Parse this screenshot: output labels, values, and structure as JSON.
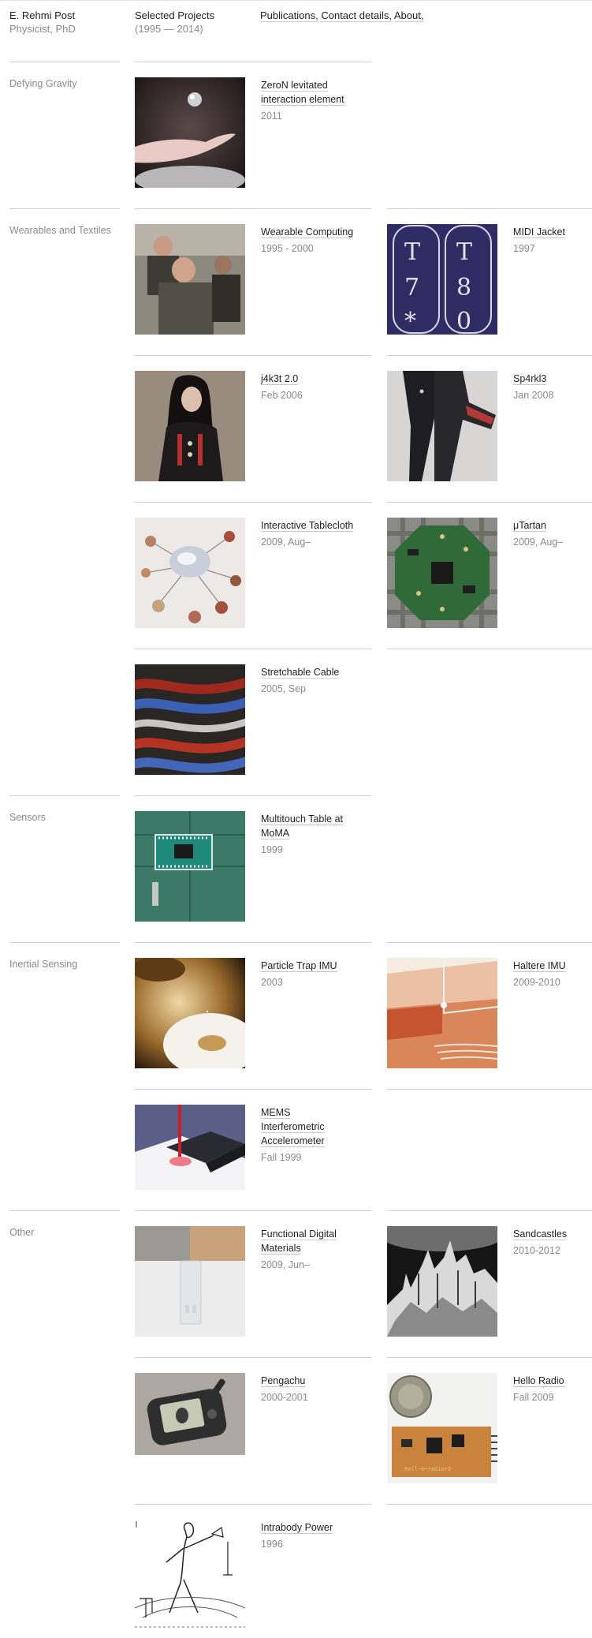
{
  "header": {
    "name": "E. Rehmi Post",
    "subtitle": "Physicist, PhD",
    "section_title": "Selected Projects",
    "section_years": "(1995 — 2014)",
    "nav": [
      "Publications,",
      "Contact details,",
      "About,"
    ]
  },
  "categories": [
    "Defying Gravity",
    "Wearables and Textiles",
    "Sensors",
    "Inertial Sensing",
    "Other"
  ],
  "projects": [
    {
      "title": "ZeroN levitated interaction element",
      "year": "2011"
    },
    {
      "title": "Wearable Computing",
      "year": "1995 - 2000"
    },
    {
      "title": "MIDI Jacket",
      "year": "1997"
    },
    {
      "title": "j4k3t 2.0",
      "year": "Feb 2006"
    },
    {
      "title": "Sp4rkl3",
      "year": "Jan 2008"
    },
    {
      "title": "Interactive Tablecloth",
      "year": "2009, Aug–"
    },
    {
      "title": "μTartan",
      "year": "2009, Aug–"
    },
    {
      "title": "Stretchable Cable",
      "year": "2005, Sep"
    },
    {
      "title": "Multitouch Table at MoMA",
      "year": "1999"
    },
    {
      "title": "Particle Trap IMU",
      "year": "2003"
    },
    {
      "title": "Haltere IMU",
      "year": "2009-2010"
    },
    {
      "title": "MEMS Interferometric Accelerometer",
      "year": "Fall 1999"
    },
    {
      "title": "Functional Digital Materials",
      "year": "2009, Jun–"
    },
    {
      "title": "Sandcastles",
      "year": "2010-2012"
    },
    {
      "title": "Pengachu",
      "year": "2000-2001"
    },
    {
      "title": "Hello Radio",
      "year": "Fall 2009"
    },
    {
      "title": "Intrabody Power",
      "year": "1996"
    }
  ],
  "thumb_texts": {
    "midi_jacket": [
      "T",
      "T",
      "7",
      "8",
      "*",
      "0"
    ],
    "hello_radio_board": "hell~o~radio+3"
  }
}
